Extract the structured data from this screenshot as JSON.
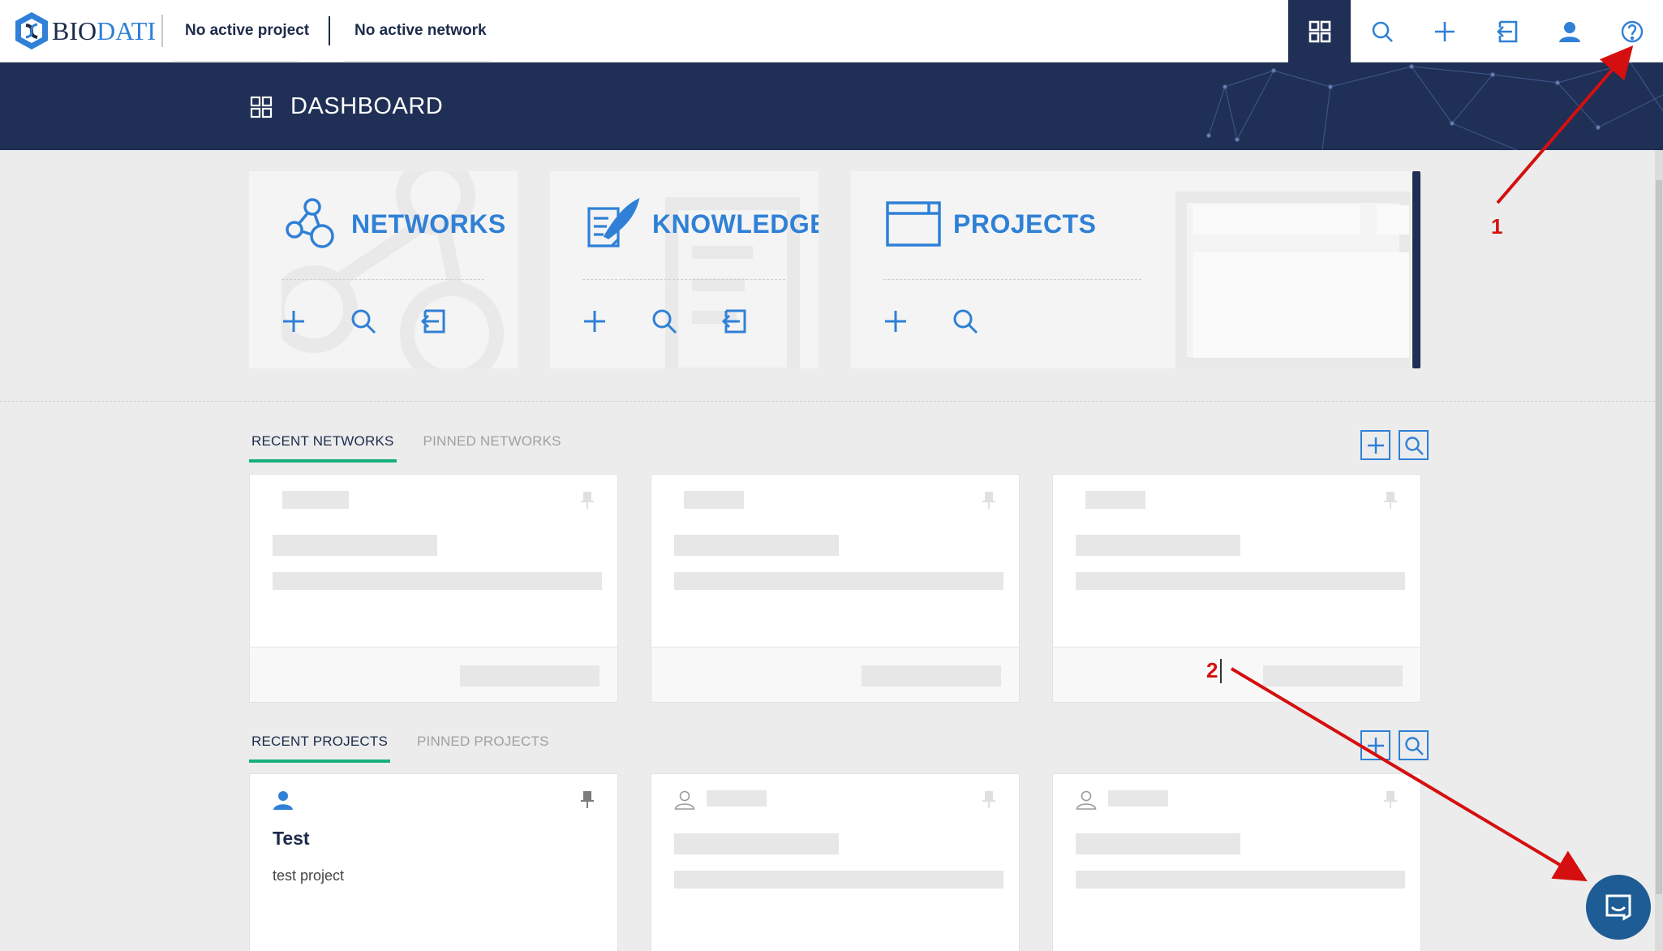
{
  "brand": {
    "logo_part1": "BIO",
    "logo_part2": "DATI"
  },
  "topbar": {
    "active_project": "No active project",
    "active_network": "No active network",
    "icons": [
      "dashboard-icon",
      "search-icon",
      "plus-icon",
      "import-icon",
      "user-icon",
      "help-icon"
    ]
  },
  "header": {
    "title": "DASHBOARD"
  },
  "tiles": [
    {
      "title": "NETWORKS",
      "icon": "network-icon",
      "actions": [
        "plus-icon",
        "search-icon",
        "import-icon"
      ]
    },
    {
      "title": "KNOWLEDGE",
      "icon": "knowledge-icon",
      "actions": [
        "plus-icon",
        "search-icon",
        "import-icon"
      ]
    },
    {
      "title": "PROJECTS",
      "icon": "projects-icon",
      "actions": [
        "plus-icon",
        "search-icon"
      ]
    }
  ],
  "networks_section": {
    "tab_recent": "RECENT NETWORKS",
    "tab_pinned": "PINNED NETWORKS"
  },
  "projects_section": {
    "tab_recent": "RECENT PROJECTS",
    "tab_pinned": "PINNED PROJECTS"
  },
  "project_card": {
    "title": "Test",
    "description": "test project"
  },
  "annotations": {
    "label_1": "1",
    "label_2": "2"
  },
  "colors": {
    "navy": "#1f2f55",
    "accent_blue": "#2f80d6",
    "tab_underline": "#18b07a",
    "annotation_red": "#d50f0f",
    "chat": "#1d5c94"
  }
}
